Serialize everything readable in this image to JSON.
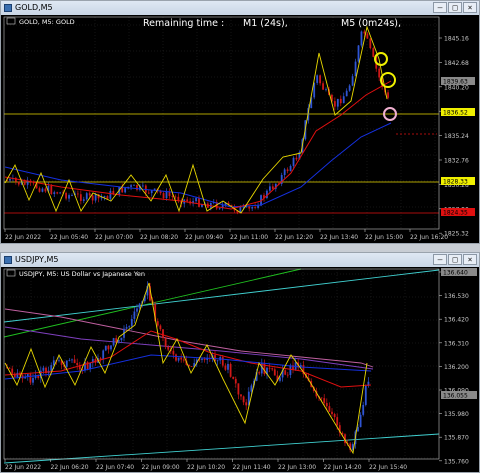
{
  "colors": {
    "bg": "#000000",
    "grid": "#2b2b2b",
    "axis": "#c0c0c0",
    "text": "#c8c8c8",
    "bull": "#2f55d4",
    "bear": "#d01818",
    "zigzag": "#e8d800",
    "ma_red": "#e01010",
    "ma_blue": "#1530e0",
    "ma_pink": "#c060a0",
    "ma_purple": "#8040c0",
    "line_green": "#20c020",
    "line_cyan": "#40d0d0",
    "level_yellow": "#e8d800",
    "level_red": "#e01010",
    "label_yellow": "#f0f000",
    "label_red": "#e01010",
    "label_gray": "#8a8a8a"
  },
  "gold": {
    "window_title": "GOLD,M5",
    "chart_label": "GOLD, M5: GOLD",
    "remaining_time": "Remaining time :",
    "m1_timer": "M1 (24s),",
    "m5_timer": "M5 (0m24s),",
    "price_ticks": [
      "1845.16",
      "1842.68",
      "1840.20",
      "1837.72",
      "1835.24",
      "1832.76",
      "1830.28",
      "1827.80",
      "1825.32"
    ],
    "price_labels": [
      {
        "text": "1839.63",
        "color": "gray"
      },
      {
        "text": "1836.52",
        "color": "yellow"
      },
      {
        "text": "1828.33",
        "color": "yellow"
      },
      {
        "text": "1824.35",
        "color": "red"
      }
    ],
    "time_ticks": [
      "22 Jun 2022",
      "22 Jun 05:40",
      "22 Jun 07:00",
      "22 Jun 08:20",
      "22 Jun 09:40",
      "22 Jun 11:00",
      "22 Jun 12:20",
      "22 Jun 13:40",
      "22 Jun 15:00",
      "22 Jun 16:20"
    ]
  },
  "usdjpy": {
    "window_title": "USDJPY,M5",
    "chart_label": "USDJPY, M5:  US Dollar vs Japanese Yen",
    "price_ticks": [
      "136.640",
      "136.530",
      "136.420",
      "136.310",
      "136.200",
      "136.090",
      "135.980",
      "135.870",
      "135.760"
    ],
    "price_labels": [
      {
        "text": "136.640",
        "color": "gray"
      },
      {
        "text": "136.055",
        "color": "gray"
      }
    ],
    "time_ticks": [
      "22 Jun 2022",
      "22 Jun 06:20",
      "22 Jun 07:40",
      "22 Jun 09:00",
      "22 Jun 10:20",
      "22 Jun 11:40",
      "22 Jun 13:00",
      "22 Jun 14:20",
      "22 Jun 15:40"
    ]
  },
  "window_controls": {
    "minimize": "–",
    "maximize": "□",
    "close": "×"
  }
}
